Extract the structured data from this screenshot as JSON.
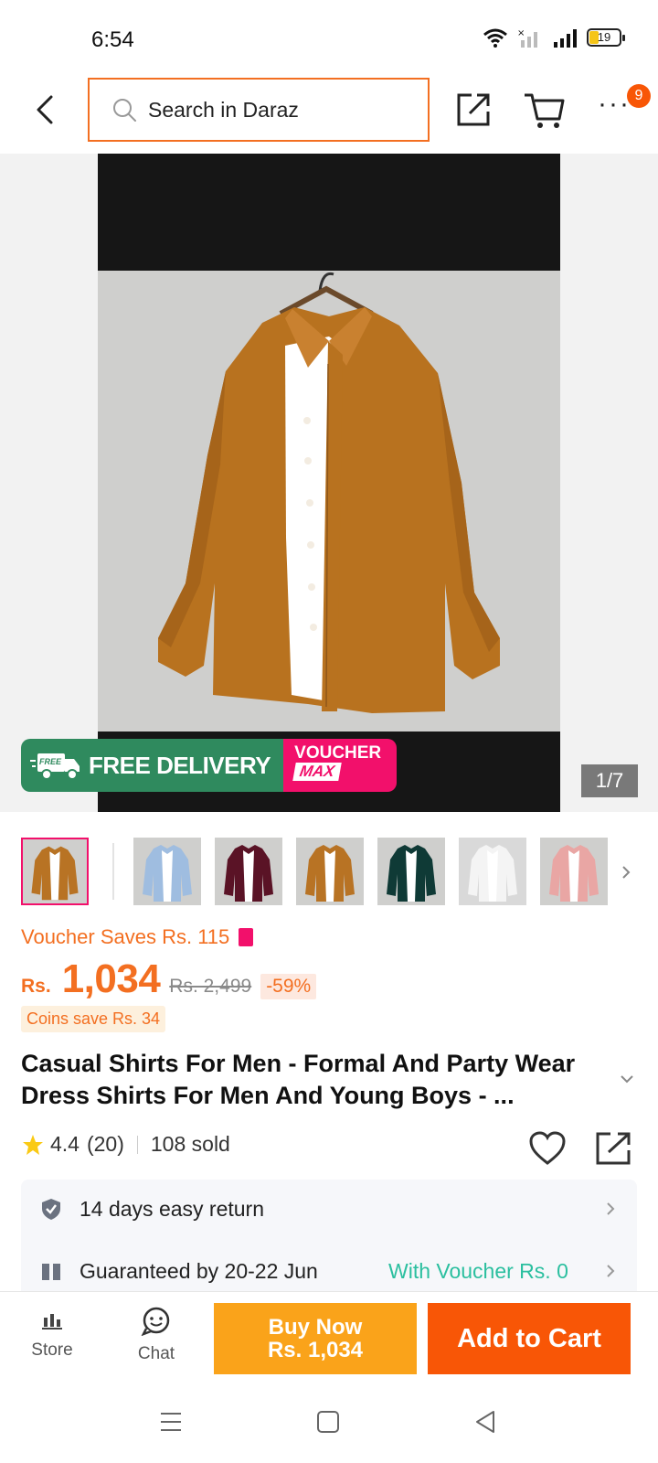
{
  "status_bar": {
    "time": "6:54",
    "battery": "19"
  },
  "header": {
    "search_placeholder": "Search in Daraz",
    "more_badge": "9"
  },
  "gallery": {
    "free_delivery": "FREE DELIVERY",
    "free_tag": "FREE",
    "voucher_line1": "VOUCHER",
    "voucher_line2": "MAX",
    "page_counter": "1/7"
  },
  "thumbnails": [
    {
      "color": "#b87324",
      "active": true
    },
    {
      "color": "#9fbde0",
      "active": false
    },
    {
      "color": "#5a1326",
      "active": false
    },
    {
      "color": "#b87324",
      "active": false
    },
    {
      "color": "#0f3a36",
      "active": false
    },
    {
      "color": "#f4f4f4",
      "active": false
    },
    {
      "color": "#e9a6a4",
      "active": false
    }
  ],
  "price": {
    "voucher_saves": "Voucher Saves Rs. 115",
    "currency": "Rs.",
    "current": "1,034",
    "original": "Rs. 2,499",
    "discount": "-59%",
    "coins": "Coins save Rs. 34"
  },
  "product": {
    "title": "Casual Shirts For Men - Formal And Party Wear Dress Shirts For Men And Young Boys - ...",
    "rating": "4.4",
    "reviews": "(20)",
    "sold": "108 sold"
  },
  "services": {
    "returns": "14 days easy return",
    "guarantee": "Guaranteed by 20-22 Jun",
    "guarantee_extra": "With Voucher Rs. 0"
  },
  "actions": {
    "store": "Store",
    "chat": "Chat",
    "buy_now_line1": "Buy Now",
    "buy_now_line2": "Rs. 1,034",
    "add_to_cart": "Add to Cart"
  },
  "colors": {
    "accent": "#f85606",
    "buy_now": "#faa31a",
    "voucher_pink": "#f2106b",
    "delivery_green": "#2f8a5e"
  }
}
